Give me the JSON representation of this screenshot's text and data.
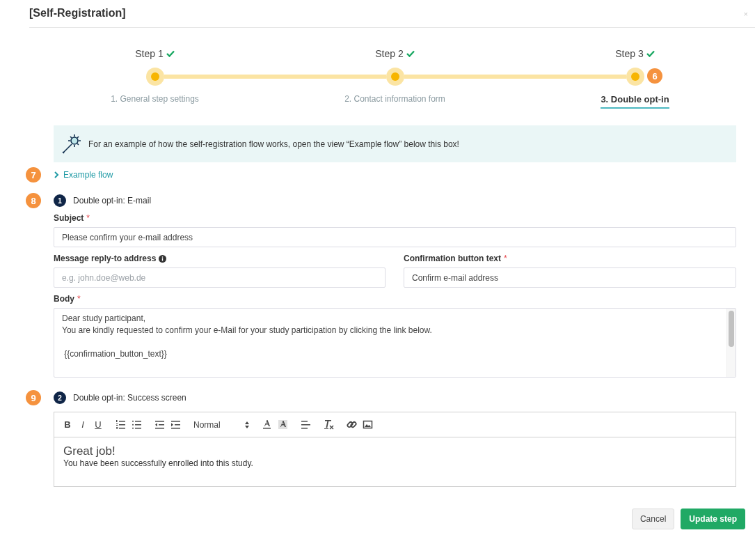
{
  "dialog": {
    "title": "[Self-Registration]",
    "close": "×"
  },
  "stepper": {
    "marker": "6",
    "steps": [
      {
        "label": "Step 1",
        "done": true,
        "caption": "1. General step settings",
        "selected": false
      },
      {
        "label": "Step 2",
        "done": true,
        "caption": "2. Contact information form",
        "selected": false
      },
      {
        "label": "Step 3",
        "done": true,
        "caption": "3. Double opt-in",
        "selected": true
      }
    ]
  },
  "info": {
    "text": "For an example of how the self-registration flow works, open the view “Example flow” below this box!"
  },
  "example_flow": {
    "marker": "7",
    "label": "Example flow",
    "expanded": false
  },
  "email_section": {
    "marker": "8",
    "number": "1",
    "title": "Double opt-in: E-mail",
    "subject": {
      "label": "Subject",
      "required_mark": "*",
      "value": "Please confirm your e-mail address"
    },
    "reply_to": {
      "label": "Message reply-to address",
      "placeholder": "e.g. john.doe@web.de"
    },
    "button_text": {
      "label": "Confirmation button text",
      "required_mark": "*",
      "value": "Confirm e-mail address"
    },
    "body": {
      "label": "Body",
      "required_mark": "*",
      "paragraphs": [
        [
          "Dear study participant,",
          "You are kindly requested to confirm your e-Mail for your study participation by clicking the link below."
        ],
        [
          " {{confirmation_button_text}}"
        ]
      ]
    }
  },
  "success_section": {
    "marker": "9",
    "number": "2",
    "title": "Double opt-in: Success screen",
    "toolbar": [
      [
        {
          "kind": "bold",
          "label": "B"
        },
        {
          "kind": "italic",
          "label": "I"
        },
        {
          "kind": "underline",
          "label": "U"
        }
      ],
      [
        {
          "kind": "ordered-list"
        },
        {
          "kind": "bullet-list"
        }
      ],
      [
        {
          "kind": "outdent"
        },
        {
          "kind": "indent"
        }
      ],
      [
        {
          "kind": "select",
          "label": "Normal"
        }
      ],
      [
        {
          "kind": "text-color"
        },
        {
          "kind": "background-color"
        }
      ],
      [
        {
          "kind": "align"
        }
      ],
      [
        {
          "kind": "clear-format"
        }
      ],
      [
        {
          "kind": "link"
        },
        {
          "kind": "image"
        }
      ]
    ],
    "heading": "Great job!",
    "text": "You have been successfully enrolled into this study."
  },
  "buttons": [
    {
      "kind": "secondary",
      "label": "Cancel"
    },
    {
      "kind": "primary",
      "label": "Update step"
    }
  ]
}
